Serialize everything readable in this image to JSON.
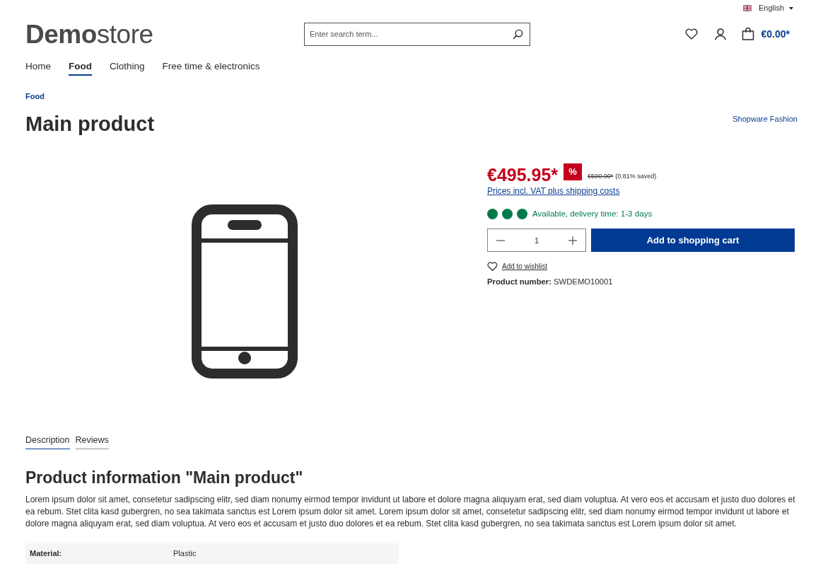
{
  "top_bar": {
    "language": "English"
  },
  "header": {
    "logo": {
      "bold": "Demo",
      "light": "store"
    },
    "search": {
      "placeholder": "Enter search term..."
    },
    "cart_total": "€0.00*"
  },
  "nav": [
    {
      "label": "Home",
      "selected": false
    },
    {
      "label": "Food",
      "selected": true
    },
    {
      "label": "Clothing",
      "selected": false
    },
    {
      "label": "Free time & electronics",
      "selected": false
    }
  ],
  "breadcrumb": [
    "Food"
  ],
  "product": {
    "title": "Main product",
    "manufacturer": "Shopware Fashion",
    "price": "€495.95*",
    "discount_badge": "%",
    "list_price": "€500.00*",
    "saving": "(0.81% saved)",
    "tax_link": "Prices incl. VAT plus shipping costs",
    "delivery": {
      "kind": "available",
      "text": "Available, delivery time: 1-3 days"
    },
    "quantity": "1",
    "add_to_cart": "Add to shopping cart",
    "wishlist": "Add to wishlist",
    "product_number": {
      "label": "Product number:",
      "value": "SWDEMO10001"
    }
  },
  "tabs": [
    {
      "label": "Description",
      "selected": true
    },
    {
      "label": "Reviews",
      "selected": false
    }
  ],
  "description": {
    "heading": "Product information \"Main product\"",
    "text": "Lorem ipsum dolor sit amet, consetetur sadipscing elitr, sed diam nonumy eirmod tempor invidunt ut labore et dolore magna aliquyam erat, sed diam voluptua. At vero eos et accusam et justo duo dolores et ea rebum. Stet clita kasd gubergren, no sea takimata sanctus est Lorem ipsum dolor sit amet. Lorem ipsum dolor sit amet, consetetur sadipscing elitr, sed diam nonumy eirmod tempor invidunt ut labore et dolore magna aliquyam erat, sed diam voluptua. At vero eos et accusam et justo duo dolores et ea rebum. Stet clita kasd gubergren, no sea takimata sanctus est Lorem ipsum dolor sit amet.",
    "properties": [
      {
        "label": "Material:",
        "value": "Plastic"
      }
    ]
  }
}
